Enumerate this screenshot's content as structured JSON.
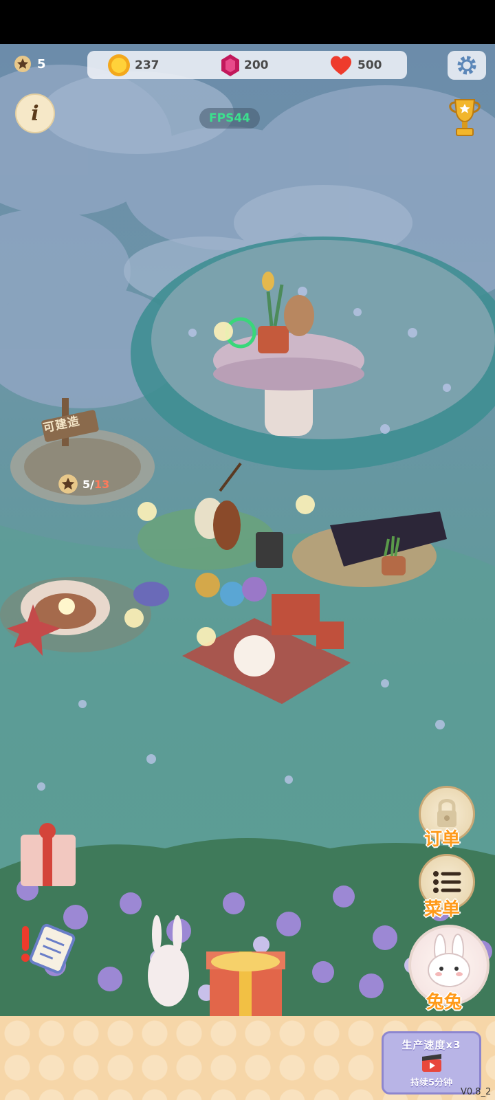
{
  "hud": {
    "stars": "5",
    "coins": "237",
    "gems": "200",
    "hearts": "500",
    "fps": "FPS44"
  },
  "map": {
    "build_sign": "可建造",
    "build_progress_current": "5/",
    "build_progress_max": "13"
  },
  "side_menu": {
    "orders_label": "订单",
    "menu_label": "菜单",
    "rabbit_label": "兔兔"
  },
  "boost": {
    "title": "生产速度x3",
    "duration": "持续5分钟"
  },
  "version": "V0.8_2",
  "icons": [
    "star-icon",
    "coin-icon",
    "gem-icon",
    "heart-icon",
    "gear-icon",
    "info-icon",
    "trophy-icon",
    "lock-icon",
    "list-icon",
    "rabbit-icon",
    "gift-icon",
    "clipboard-icon",
    "video-icon"
  ],
  "colors": {
    "accent_orange": "#ff9a1a",
    "fps_green": "#3ce08e",
    "boost_purple": "#b8b4e6"
  }
}
